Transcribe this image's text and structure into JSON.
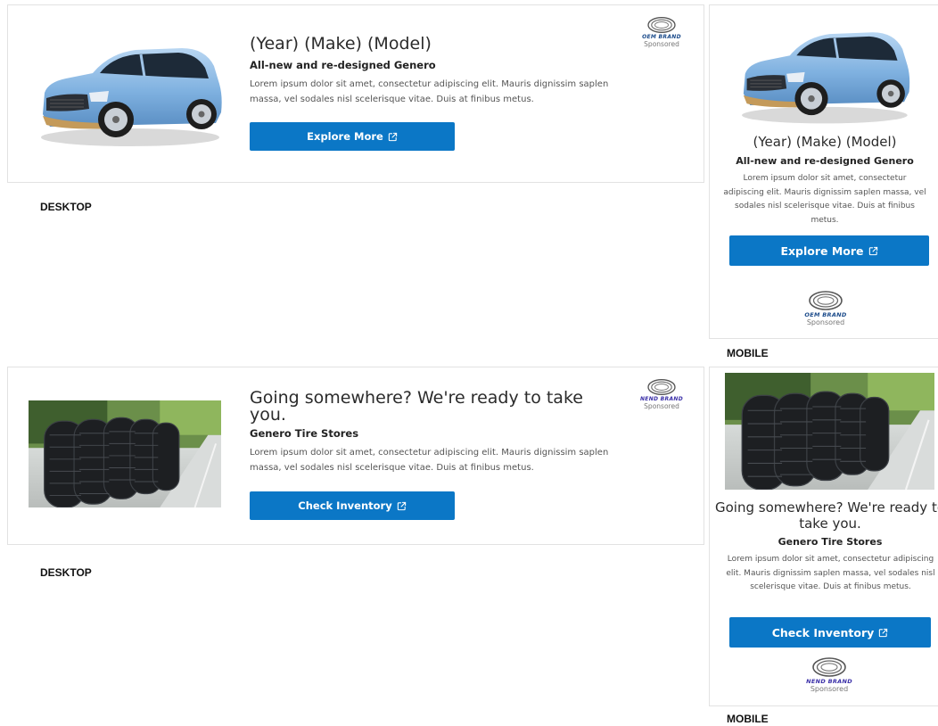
{
  "desktop_label": "DESKTOP",
  "mobile_label": "MOBILE",
  "ad_car": {
    "title": "(Year) (Make) (Model)",
    "subtitle": "All-new and re-designed Genero",
    "body": "Lorem ipsum dolor sit amet, consectetur adipiscing elit. Mauris dignissim saplen massa, vel sodales nisl scelerisque vitae. Duis at finibus metus.",
    "cta": "Explore More",
    "brand_name": "OEM BRAND",
    "sponsored": "Sponsored",
    "brand_color": "#1a4a8a"
  },
  "ad_tire": {
    "title": "Going somewhere? We're ready to take you.",
    "subtitle": "Genero Tire Stores",
    "body": "Lorem ipsum dolor sit amet, consectetur adipiscing elit. Mauris dignissim saplen massa, vel sodales nisl scelerisque vitae. Duis at finibus metus.",
    "cta": "Check Inventory",
    "brand_name": "NEND BRAND",
    "sponsored": "Sponsored",
    "brand_color": "#3a2fa8"
  },
  "colors": {
    "cta_blue": "#0b77c6",
    "card_border": "#e2e2e2"
  },
  "icons": {
    "cta_icon": "external-link-icon",
    "brand_logo": "oval-ring-logo"
  }
}
